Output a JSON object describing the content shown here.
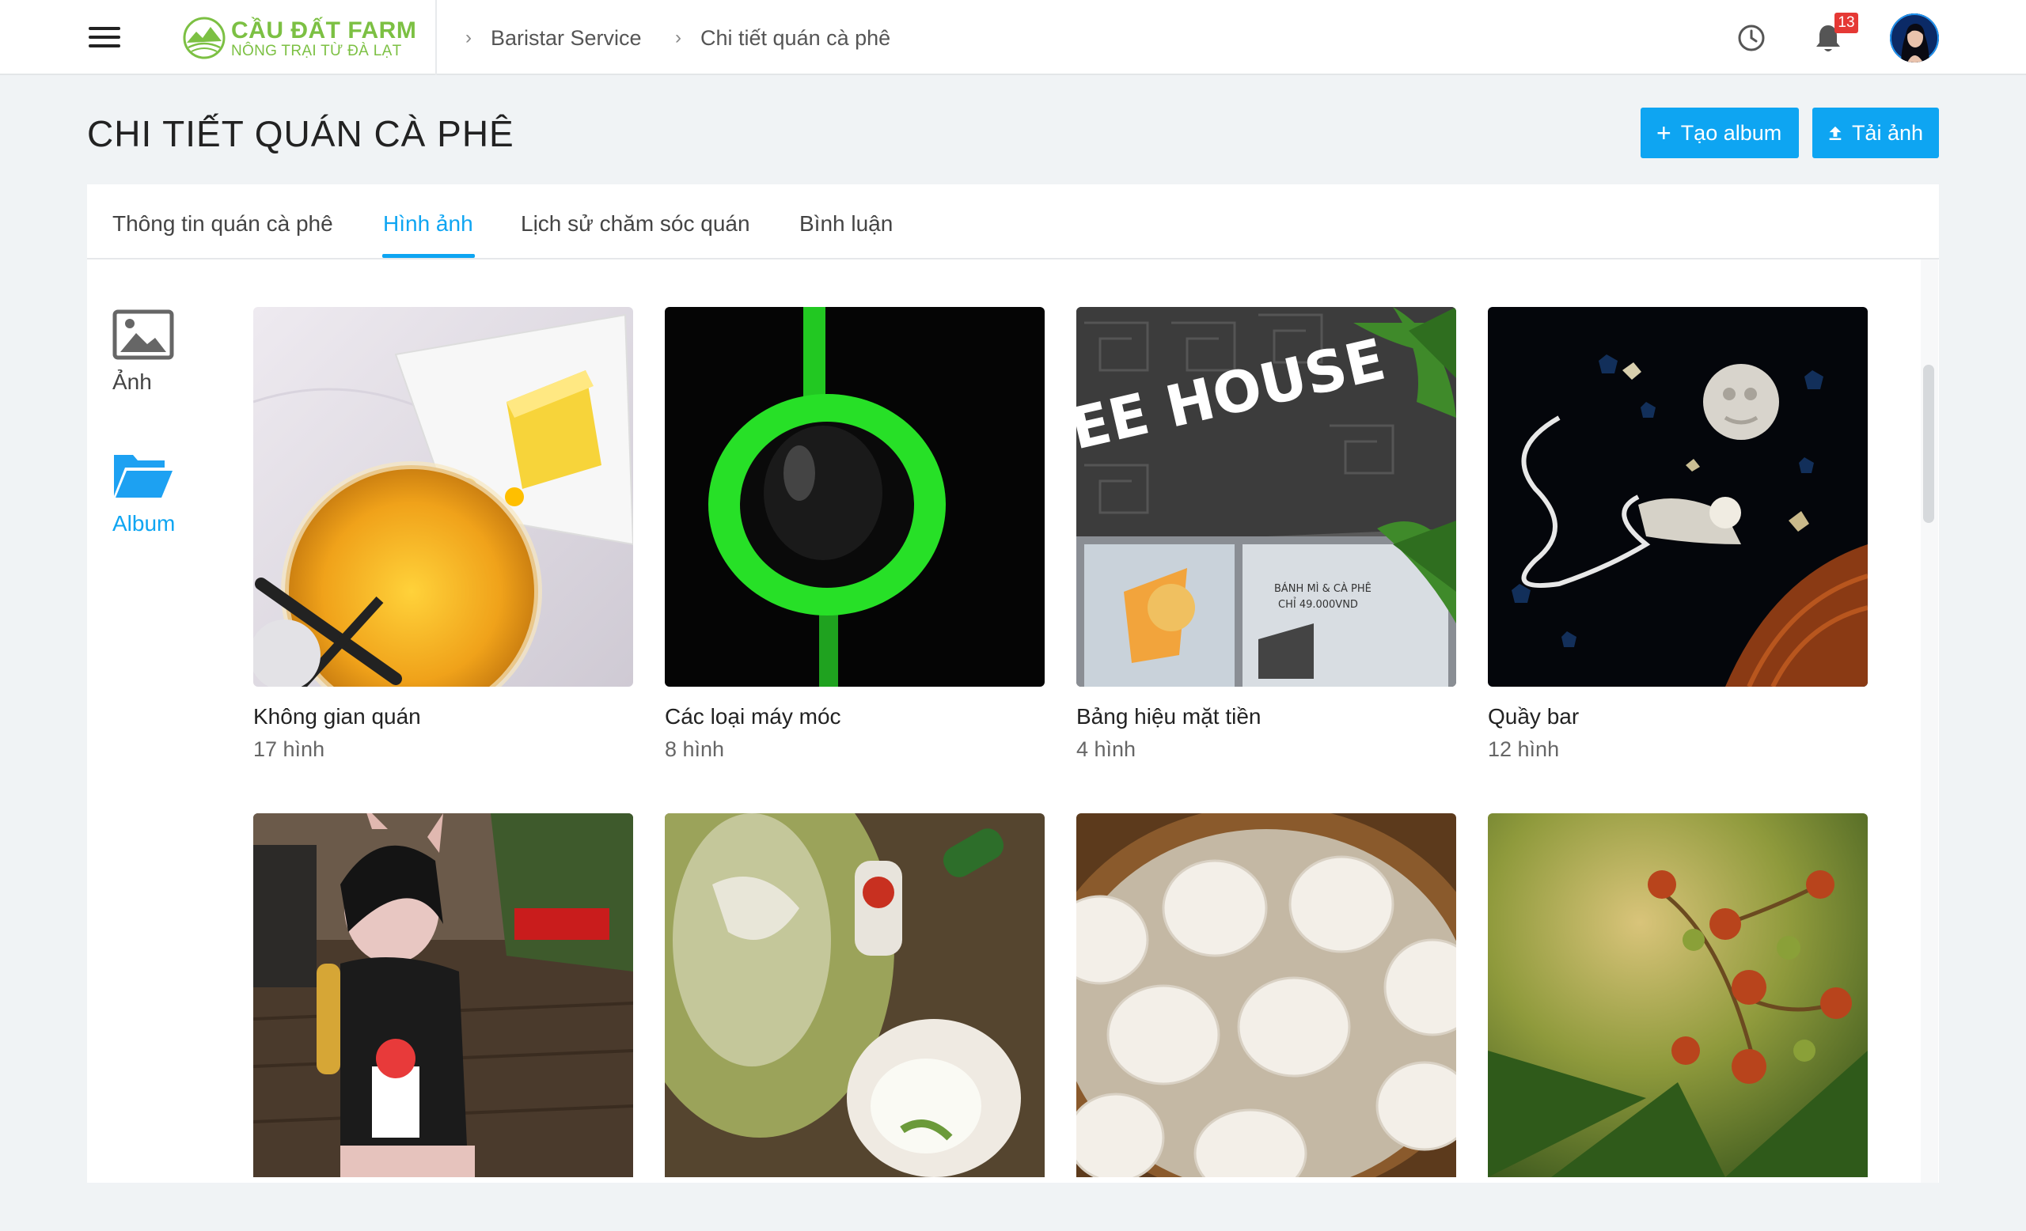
{
  "header": {
    "logo": {
      "title": "CẦU ĐẤT FARM",
      "subtitle": "NÔNG TRẠI TỪ ĐÀ LẠT"
    },
    "breadcrumbs": [
      "Baristar Service",
      "Chi tiết quán cà phê"
    ],
    "notification_count": "13",
    "icons": [
      "menu-icon",
      "clock-icon",
      "bell-icon",
      "avatar"
    ]
  },
  "page": {
    "title": "CHI TIẾT QUÁN CÀ PHÊ",
    "create_album_label": "Tạo album",
    "upload_label": "Tải ảnh"
  },
  "tabs": [
    {
      "label": "Thông tin quán cà phê",
      "active": false
    },
    {
      "label": "Hình ảnh",
      "active": true
    },
    {
      "label": "Lịch sử chăm sóc quán",
      "active": false
    },
    {
      "label": "Bình luận",
      "active": false
    }
  ],
  "side_menu": [
    {
      "label": "Ảnh",
      "icon": "image-icon",
      "active": false
    },
    {
      "label": "Album",
      "icon": "folder-open-icon",
      "active": true
    }
  ],
  "albums": [
    {
      "name": "Không gian quán",
      "count": "17 hình"
    },
    {
      "name": "Các loại máy móc",
      "count": "8 hình"
    },
    {
      "name": "Bảng hiệu mặt tiền",
      "count": "4 hình"
    },
    {
      "name": "Quầy bar",
      "count": "12 hình"
    },
    {
      "name": "",
      "count": ""
    },
    {
      "name": "",
      "count": ""
    },
    {
      "name": "",
      "count": ""
    },
    {
      "name": "",
      "count": ""
    }
  ],
  "photo_text": {
    "storefront_sign": "EE HOUSE",
    "poster_line1": "BÁNH MÌ & CÀ PHÊ",
    "poster_line2": "CHỈ 49.000VND"
  },
  "colors": {
    "accent": "#0ea5f2",
    "brand_green": "#7cc043",
    "badge": "#e53935"
  }
}
